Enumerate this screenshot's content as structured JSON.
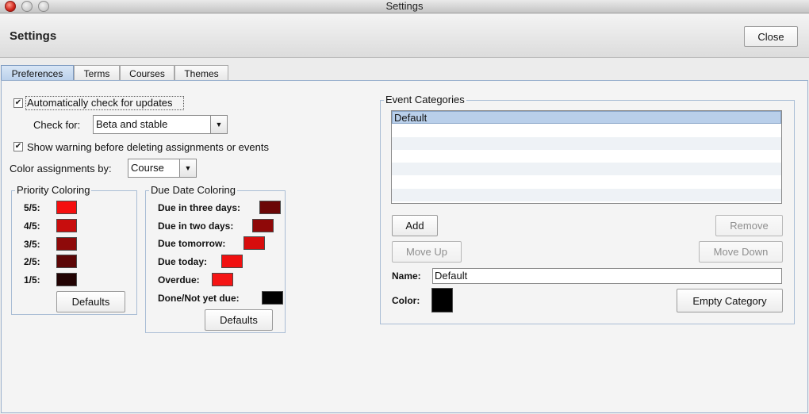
{
  "window": {
    "title": "Settings"
  },
  "header": {
    "title": "Settings",
    "close_label": "Close"
  },
  "tabs": [
    {
      "label": "Preferences",
      "active": true
    },
    {
      "label": "Terms",
      "active": false
    },
    {
      "label": "Courses",
      "active": false
    },
    {
      "label": "Themes",
      "active": false
    }
  ],
  "preferences": {
    "auto_update": {
      "label": "Automatically check for updates",
      "checked": true
    },
    "check_for": {
      "label": "Check for:",
      "value": "Beta and stable"
    },
    "warn_delete": {
      "label": "Show warning before deleting assignments or events",
      "checked": true
    },
    "color_by": {
      "label": "Color assignments by:",
      "value": "Course"
    }
  },
  "priority_coloring": {
    "title": "Priority Coloring",
    "items": [
      {
        "label": "5/5:",
        "color": "#f50f0f"
      },
      {
        "label": "4/5:",
        "color": "#c80d0d"
      },
      {
        "label": "3/5:",
        "color": "#8e0a0a"
      },
      {
        "label": "2/5:",
        "color": "#5c0606"
      },
      {
        "label": "1/5:",
        "color": "#220303"
      }
    ],
    "defaults_label": "Defaults"
  },
  "due_date_coloring": {
    "title": "Due Date Coloring",
    "items": [
      {
        "label": "Due in three days:",
        "color": "#6b0606"
      },
      {
        "label": "Due in two days:",
        "color": "#8f0808"
      },
      {
        "label": "Due tomorrow:",
        "color": "#d80d0d"
      },
      {
        "label": "Due today:",
        "color": "#f01010"
      },
      {
        "label": "Overdue:",
        "color": "#f51414"
      },
      {
        "label": "Done/Not yet due:",
        "color": "#000000"
      }
    ],
    "defaults_label": "Defaults"
  },
  "event_categories": {
    "title": "Event Categories",
    "items": [
      "Default"
    ],
    "selected": "Default",
    "add_label": "Add",
    "remove_label": "Remove",
    "move_up_label": "Move Up",
    "move_down_label": "Move Down",
    "name_label": "Name:",
    "name_value": "Default",
    "color_label": "Color:",
    "color_value": "#000000",
    "empty_label": "Empty Category"
  }
}
